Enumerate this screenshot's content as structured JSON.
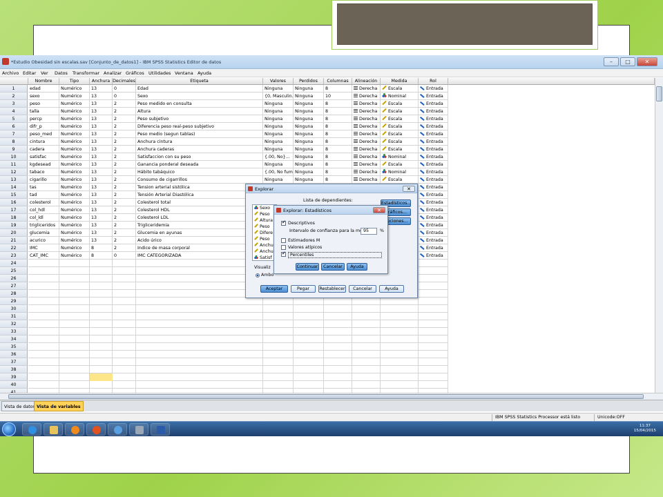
{
  "window": {
    "title": "*Estudio Obesidad sin escalas.sav [Conjunto_de_datos1] - IBM SPSS Statistics Editor de datos",
    "min_label": "–",
    "max_label": "□",
    "close_label": "✕"
  },
  "menu": [
    "Archivo",
    "Editar",
    "Ver",
    "Datos",
    "Transformar",
    "Analizar",
    "Gráficos",
    "Utilidades",
    "Ventana",
    "Ayuda"
  ],
  "columns": [
    "Nombre",
    "Tipo",
    "Anchura",
    "Decimales",
    "Etiqueta",
    "Valores",
    "Perdidos",
    "Columnas",
    "Alineación",
    "Medida",
    "Rol"
  ],
  "variables": [
    {
      "nombre": "edad",
      "tipo": "Numérico",
      "anchura": "13",
      "decimales": "0",
      "etiqueta": "Edad",
      "valores": "Ninguna",
      "perdidos": "Ninguna",
      "columnas": "8",
      "alineacion": "Derecha",
      "medida": "Escala",
      "rol": "Entrada"
    },
    {
      "nombre": "sexo",
      "tipo": "Numérico",
      "anchura": "13",
      "decimales": "0",
      "etiqueta": "Sexo",
      "valores": "{0, Masculin...",
      "perdidos": "Ninguna",
      "columnas": "10",
      "alineacion": "Derecha",
      "medida": "Nominal",
      "rol": "Entrada"
    },
    {
      "nombre": "peso",
      "tipo": "Numérico",
      "anchura": "13",
      "decimales": "2",
      "etiqueta": "Peso medido en consulta",
      "valores": "Ninguna",
      "perdidos": "Ninguna",
      "columnas": "8",
      "alineacion": "Derecha",
      "medida": "Escala",
      "rol": "Entrada"
    },
    {
      "nombre": "talla",
      "tipo": "Numérico",
      "anchura": "13",
      "decimales": "2",
      "etiqueta": "Altura",
      "valores": "Ninguna",
      "perdidos": "Ninguna",
      "columnas": "8",
      "alineacion": "Derecha",
      "medida": "Escala",
      "rol": "Entrada"
    },
    {
      "nombre": "percp",
      "tipo": "Numérico",
      "anchura": "13",
      "decimales": "2",
      "etiqueta": "Peso subjetivo",
      "valores": "Ninguna",
      "perdidos": "Ninguna",
      "columnas": "8",
      "alineacion": "Derecha",
      "medida": "Escala",
      "rol": "Entrada"
    },
    {
      "nombre": "difr_p",
      "tipo": "Numérico",
      "anchura": "13",
      "decimales": "2",
      "etiqueta": "Diferencia peso real-peso subjetivo",
      "valores": "Ninguna",
      "perdidos": "Ninguna",
      "columnas": "8",
      "alineacion": "Derecha",
      "medida": "Escala",
      "rol": "Entrada"
    },
    {
      "nombre": "peso_med",
      "tipo": "Numérico",
      "anchura": "13",
      "decimales": "2",
      "etiqueta": "Peso medio (segun tablas)",
      "valores": "Ninguna",
      "perdidos": "Ninguna",
      "columnas": "8",
      "alineacion": "Derecha",
      "medida": "Escala",
      "rol": "Entrada"
    },
    {
      "nombre": "cintura",
      "tipo": "Numérico",
      "anchura": "13",
      "decimales": "2",
      "etiqueta": "Anchura cintura",
      "valores": "Ninguna",
      "perdidos": "Ninguna",
      "columnas": "8",
      "alineacion": "Derecha",
      "medida": "Escala",
      "rol": "Entrada"
    },
    {
      "nombre": "cadera",
      "tipo": "Numérico",
      "anchura": "13",
      "decimales": "2",
      "etiqueta": "Anchura caderas",
      "valores": "Ninguna",
      "perdidos": "Ninguna",
      "columnas": "8",
      "alineacion": "Derecha",
      "medida": "Escala",
      "rol": "Entrada"
    },
    {
      "nombre": "satisfac",
      "tipo": "Numérico",
      "anchura": "13",
      "decimales": "2",
      "etiqueta": "Satisfaccion con su peso",
      "valores": "{.00, No}...",
      "perdidos": "Ninguna",
      "columnas": "8",
      "alineacion": "Derecha",
      "medida": "Nominal",
      "rol": "Entrada"
    },
    {
      "nombre": "kgdesead",
      "tipo": "Numérico",
      "anchura": "13",
      "decimales": "2",
      "etiqueta": "Ganancia ponderal deseada",
      "valores": "Ninguna",
      "perdidos": "Ninguna",
      "columnas": "8",
      "alineacion": "Derecha",
      "medida": "Escala",
      "rol": "Entrada"
    },
    {
      "nombre": "tabaco",
      "tipo": "Numérico",
      "anchura": "13",
      "decimales": "2",
      "etiqueta": "Hábito tabáquico",
      "valores": "{.00, No fum...",
      "perdidos": "Ninguna",
      "columnas": "8",
      "alineacion": "Derecha",
      "medida": "Nominal",
      "rol": "Entrada"
    },
    {
      "nombre": "cigarillo",
      "tipo": "Numérico",
      "anchura": "13",
      "decimales": "2",
      "etiqueta": "Consumo de cigarrillos",
      "valores": "Ninguna",
      "perdidos": "Ninguna",
      "columnas": "8",
      "alineacion": "Derecha",
      "medida": "Escala",
      "rol": "Entrada"
    },
    {
      "nombre": "tas",
      "tipo": "Numérico",
      "anchura": "13",
      "decimales": "2",
      "etiqueta": "Tension arterial sistólica",
      "valores": "",
      "perdidos": "",
      "columnas": "",
      "alineacion": "",
      "medida": "",
      "rol": "Entrada"
    },
    {
      "nombre": "tad",
      "tipo": "Numérico",
      "anchura": "13",
      "decimales": "2",
      "etiqueta": "Tensión Arterial Diastólica",
      "valores": "",
      "perdidos": "",
      "columnas": "",
      "alineacion": "",
      "medida": "",
      "rol": "Entrada"
    },
    {
      "nombre": "colesterol",
      "tipo": "Numérico",
      "anchura": "13",
      "decimales": "2",
      "etiqueta": "Colesterol total",
      "valores": "",
      "perdidos": "",
      "columnas": "",
      "alineacion": "",
      "medida": "",
      "rol": "Entrada"
    },
    {
      "nombre": "col_hdl",
      "tipo": "Numérico",
      "anchura": "13",
      "decimales": "2",
      "etiqueta": "Colesterol HDL",
      "valores": "",
      "perdidos": "",
      "columnas": "",
      "alineacion": "",
      "medida": "",
      "rol": "Entrada"
    },
    {
      "nombre": "col_ldl",
      "tipo": "Numérico",
      "anchura": "13",
      "decimales": "2",
      "etiqueta": "Colesterol LDL",
      "valores": "",
      "perdidos": "",
      "columnas": "",
      "alineacion": "",
      "medida": "",
      "rol": "Entrada"
    },
    {
      "nombre": "trigliceridos",
      "tipo": "Numérico",
      "anchura": "13",
      "decimales": "2",
      "etiqueta": "Trigliceridemia",
      "valores": "",
      "perdidos": "",
      "columnas": "",
      "alineacion": "",
      "medida": "",
      "rol": "Entrada"
    },
    {
      "nombre": "glucemia",
      "tipo": "Numérico",
      "anchura": "13",
      "decimales": "2",
      "etiqueta": "Glucemia en ayunas",
      "valores": "",
      "perdidos": "",
      "columnas": "",
      "alineacion": "",
      "medida": "",
      "rol": "Entrada"
    },
    {
      "nombre": "acurico",
      "tipo": "Numérico",
      "anchura": "13",
      "decimales": "2",
      "etiqueta": "Acido úrico",
      "valores": "",
      "perdidos": "",
      "columnas": "",
      "alineacion": "",
      "medida": "",
      "rol": "Entrada"
    },
    {
      "nombre": "IMC",
      "tipo": "Numérico",
      "anchura": "8",
      "decimales": "2",
      "etiqueta": "Indice de masa corporal",
      "valores": "",
      "perdidos": "",
      "columnas": "",
      "alineacion": "",
      "medida": "",
      "rol": "Entrada"
    },
    {
      "nombre": "CAT_IMC",
      "tipo": "Numérico",
      "anchura": "8",
      "decimales": "0",
      "etiqueta": "IMC CATEGORIZADA",
      "valores": "",
      "perdidos": "",
      "columnas": "",
      "alineacion": "",
      "medida": "",
      "rol": "Entrada"
    }
  ],
  "row_numbers": [
    "1",
    "2",
    "3",
    "4",
    "5",
    "6",
    "7",
    "8",
    "9",
    "10",
    "11",
    "12",
    "13",
    "14",
    "15",
    "16",
    "17",
    "18",
    "19",
    "20",
    "21",
    "22",
    "23",
    "24",
    "25",
    "26",
    "27",
    "28",
    "29",
    "30",
    "31",
    "32",
    "33",
    "34",
    "35",
    "36",
    "37",
    "38",
    "39",
    "40",
    "41"
  ],
  "tabs": [
    "Vista de datos",
    "Vista de variables"
  ],
  "active_tab": 1,
  "status": {
    "processor": "IBM SPSS Statistics Processor está listo",
    "unicode": "Unicode:OFF"
  },
  "taskbar": {
    "time": "11:37",
    "date": "15/04/2015"
  },
  "explorar": {
    "title": "Explorar",
    "dependents_label": "Lista de dependientes:",
    "variables_list": [
      "Sexo",
      "Peso",
      "Altura",
      "Peso",
      "Difere",
      "Peso",
      "Anchu",
      "Anchu",
      "Satisf"
    ],
    "side_buttons": [
      "Estadísticos...",
      "Gráficos...",
      "Opciones..."
    ],
    "display_label": "Visualiz",
    "radio_label": "Ambo",
    "buttons": [
      "Aceptar",
      "Pegar",
      "Restablecer",
      "Cancelar",
      "Ayuda"
    ]
  },
  "estadisticos": {
    "title": "Explorar: Estadísticos",
    "descriptivos_label": "Descriptivos",
    "interval_label": "Intervalo de confianza para la media:",
    "interval_value": "95",
    "percent_sign": "%",
    "estimadores_label": "Estimadores M",
    "atipicos_label": "Valores atípicos",
    "percentiles_label": "Percentiles",
    "checks": {
      "descriptivos": true,
      "estimadores": false,
      "atipicos": false,
      "percentiles": true
    },
    "buttons": [
      "Continuar",
      "Cancelar",
      "Ayuda"
    ]
  }
}
